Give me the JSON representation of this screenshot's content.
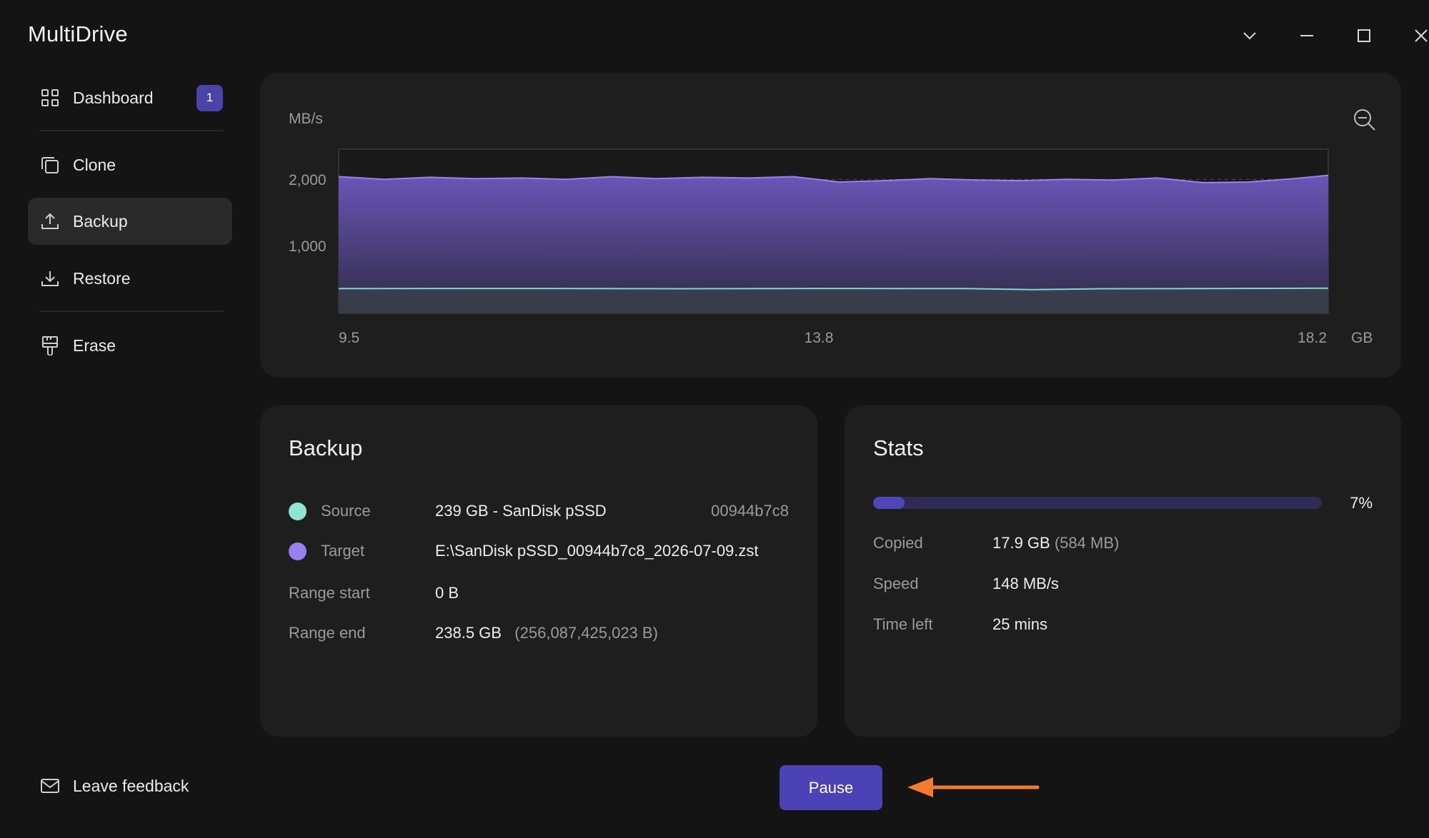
{
  "app": {
    "title": "MultiDrive"
  },
  "window_controls": [
    "chevron-down",
    "minimize",
    "maximize",
    "close"
  ],
  "sidebar": {
    "items": [
      {
        "label": "Dashboard",
        "icon": "grid-icon",
        "badge": "1"
      },
      {
        "label": "Clone",
        "icon": "copy-icon"
      },
      {
        "label": "Backup",
        "icon": "upload-icon",
        "active": true
      },
      {
        "label": "Restore",
        "icon": "download-icon"
      },
      {
        "label": "Erase",
        "icon": "eraser-icon"
      }
    ],
    "feedback_label": "Leave feedback"
  },
  "chart": {
    "y_unit": "MB/s",
    "x_unit": "GB"
  },
  "chart_data": {
    "type": "area",
    "title": "",
    "xlabel": "GB",
    "ylabel": "MB/s",
    "xlim": [
      9.5,
      18.2
    ],
    "ylim": [
      0,
      2450
    ],
    "x_ticks": [
      "9.5",
      "13.8",
      "18.2"
    ],
    "y_ticks": [
      "2,000",
      "1,000"
    ],
    "grid": "horizontal-dashed",
    "series": [
      {
        "color": "#9a82ea",
        "x": [
          9.5,
          9.9,
          10.3,
          10.7,
          11.1,
          11.5,
          11.9,
          12.3,
          12.7,
          13.1,
          13.5,
          13.9,
          14.3,
          14.7,
          15.1,
          15.5,
          15.9,
          16.3,
          16.7,
          17.1,
          17.5,
          17.9,
          18.2
        ],
        "values": [
          2040,
          2000,
          2030,
          2010,
          2020,
          2000,
          2040,
          2010,
          2030,
          2020,
          2040,
          1960,
          1980,
          2010,
          1990,
          1980,
          2000,
          1990,
          2020,
          1950,
          1960,
          2010,
          2060
        ]
      },
      {
        "color": "#7fd8d0",
        "x": [
          9.5,
          11.0,
          12.5,
          14.0,
          15.0,
          15.6,
          16.2,
          17.0,
          18.2
        ],
        "values": [
          370,
          372,
          368,
          372,
          370,
          355,
          368,
          370,
          375
        ]
      }
    ]
  },
  "backup": {
    "title": "Backup",
    "source_label": "Source",
    "source_value": "239 GB - SanDisk pSSD",
    "source_id": "00944b7c8",
    "source_color": "#8ee6cf",
    "target_label": "Target",
    "target_value": "E:\\SanDisk pSSD_00944b7c8_2026-07-09.zst",
    "target_color": "#9a7ff0",
    "range_start_label": "Range start",
    "range_start_value": "0 B",
    "range_end_label": "Range end",
    "range_end_value": "238.5 GB",
    "range_end_bytes": "(256,087,425,023 B)"
  },
  "stats": {
    "title": "Stats",
    "progress": 0.07,
    "progress_text": "7%",
    "copied_label": "Copied",
    "copied_value": "17.9 GB",
    "copied_sub": "(584 MB)",
    "speed_label": "Speed",
    "speed_value": "148 MB/s",
    "time_label": "Time left",
    "time_value": "25 mins"
  },
  "actions": {
    "pause_label": "Pause"
  },
  "colors": {
    "accent": "#4b43b5",
    "annotation": "#f47b2a"
  }
}
